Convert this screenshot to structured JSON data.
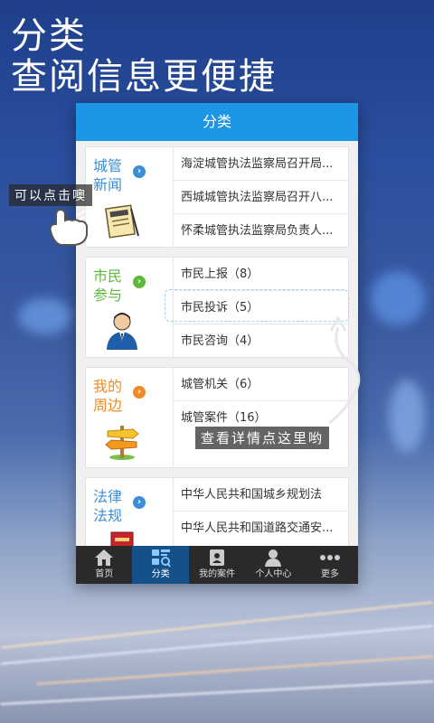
{
  "headline": {
    "line1": "分类",
    "line2": "查阅信息更便捷"
  },
  "app": {
    "title": "分类"
  },
  "categories": [
    {
      "title": "城管新闻",
      "color": "#3a8fd8",
      "icon": "news-icon",
      "items": [
        "海淀城管执法监察局召开局...",
        "西城城管执法监察局召开八...",
        "怀柔城管执法监察局负责人..."
      ]
    },
    {
      "title": "市民参与",
      "color": "#5fb83c",
      "icon": "person-icon",
      "items": [
        "市民上报（8）",
        "市民投诉（5）",
        "市民咨询（4）"
      ]
    },
    {
      "title": "我的周边",
      "color": "#f08a26",
      "icon": "signpost-icon",
      "items": [
        "城管机关（6）",
        "城管案件（16）"
      ]
    },
    {
      "title": "法律法规",
      "color": "#3a8fd8",
      "icon": "book-icon",
      "items": [
        "中华人民共和国城乡规划法",
        "中华人民共和国道路交通安..."
      ]
    }
  ],
  "tabs": [
    {
      "label": "首页",
      "icon": "home-icon",
      "active": false
    },
    {
      "label": "分类",
      "icon": "category-icon",
      "active": true
    },
    {
      "label": "我的案件",
      "icon": "cases-icon",
      "active": false
    },
    {
      "label": "个人中心",
      "icon": "user-icon",
      "active": false
    },
    {
      "label": "更多",
      "icon": "more-icon",
      "active": false
    }
  ],
  "callouts": {
    "tap_here": "可以点击噢",
    "view_details": "查看详情点这里哟"
  },
  "colors": {
    "titlebar": "#1e96e6",
    "tabbar": "#2a2a2a",
    "tab_active": "#14508a"
  }
}
